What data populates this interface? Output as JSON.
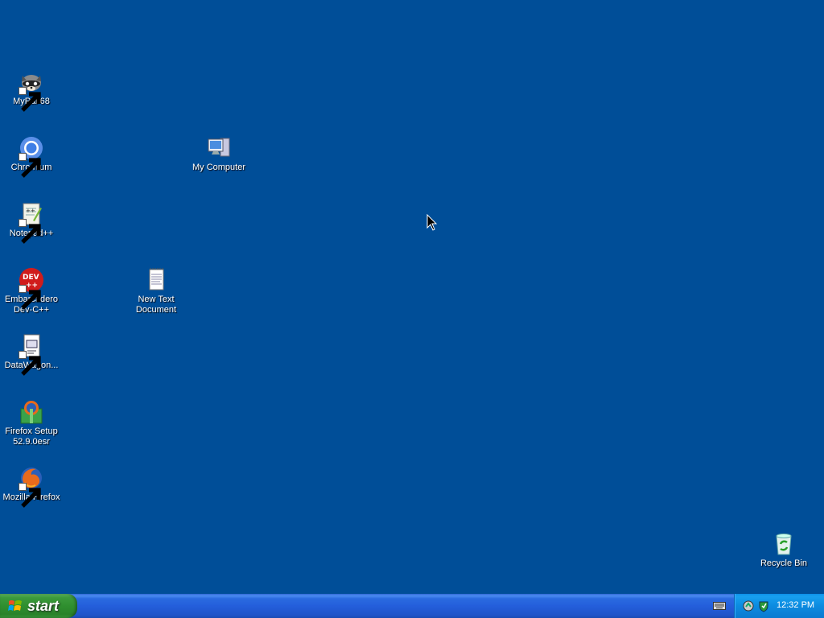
{
  "desktop": {
    "icons": [
      {
        "label": "MyPal 68",
        "icon": "mypal-raccoon-icon"
      },
      {
        "label": "Chromium",
        "icon": "chromium-icon"
      },
      {
        "label": "Notepad++",
        "icon": "notepadpp-icon"
      },
      {
        "label": "Embarcadero Dev-C++",
        "icon": "devcpp-icon"
      },
      {
        "label": "DataWagon...",
        "icon": "datawagon-icon"
      },
      {
        "label": "Firefox Setup 52.9.0esr",
        "icon": "firefox-setup-icon"
      },
      {
        "label": "Mozilla Firefox",
        "icon": "firefox-icon"
      },
      {
        "label": "My Computer",
        "icon": "my-computer-icon"
      },
      {
        "label": "New Text Document",
        "icon": "text-document-icon"
      },
      {
        "label": "Recycle Bin",
        "icon": "recycle-bin-icon"
      }
    ]
  },
  "taskbar": {
    "start_label": "start",
    "clock": "12:32 PM"
  },
  "colors": {
    "desktop_bg": "#004e98",
    "taskbar": "#245edb",
    "start_button": "#3c9a3c",
    "tray": "#0c8be0"
  }
}
